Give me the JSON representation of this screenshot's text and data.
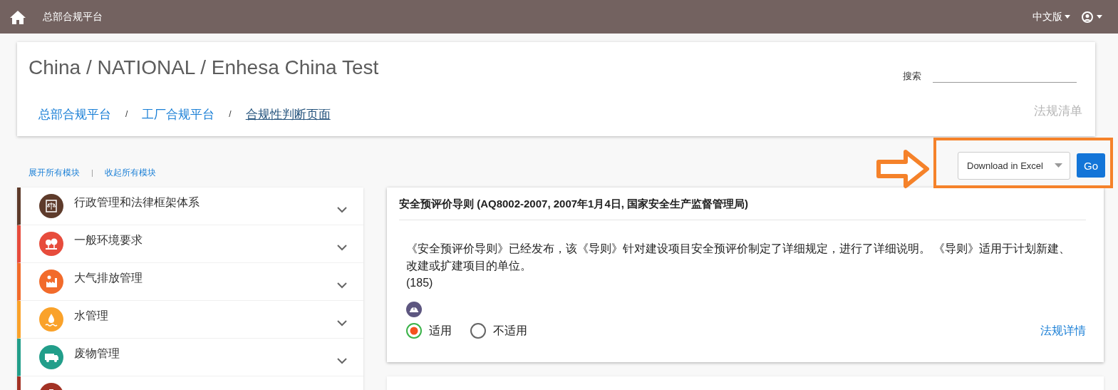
{
  "topbar": {
    "home_title": "总部合规平台",
    "language": "中文版"
  },
  "header": {
    "title": "China / NATIONAL / Enhesa China Test",
    "search_label": "搜索",
    "breadcrumbs": [
      {
        "label": "总部合规平台",
        "selected": false
      },
      {
        "label": "工厂合规平台",
        "selected": false
      },
      {
        "label": "合规性判断页面",
        "selected": true
      }
    ],
    "separator": "/",
    "right_link": "法规清单"
  },
  "toolbar": {
    "expand_all": "展开所有模块",
    "divider": "|",
    "collapse_all": "收起所有模块",
    "export_select": "Download in Excel",
    "go_button": "Go"
  },
  "sidebar": {
    "items": [
      {
        "label": "行政管理和法律框架体系",
        "color": "#5e3b2b"
      },
      {
        "label": "一般环境要求",
        "color": "#e74c3c"
      },
      {
        "label": "大气排放管理",
        "color": "#f26b2b"
      },
      {
        "label": "水管理",
        "color": "#faa22a"
      },
      {
        "label": "废物管理",
        "color": "#229e8a"
      },
      {
        "color": "#a33225"
      }
    ]
  },
  "regulation": {
    "title": "安全预评价导则 (AQ8002-2007, 2007年1月4日, 国家安全生产监督管理局)",
    "description": "《安全预评价导则》已经发布，该《导则》针对建设项目安全预评价制定了详细规定，进行了详细说明。 《导则》适用于计划新建、改建或扩建项目的单位。",
    "count": "(185)",
    "options": [
      {
        "label": "适用",
        "selected": true
      },
      {
        "label": "不适用",
        "selected": false
      }
    ],
    "detail_link": "法规详情"
  }
}
